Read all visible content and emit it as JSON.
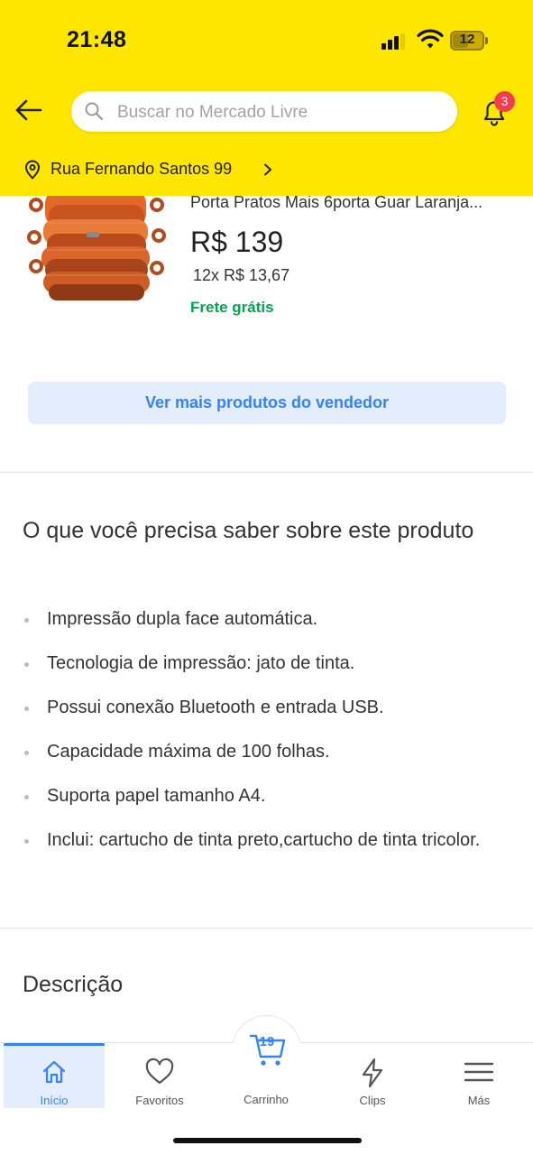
{
  "status_bar": {
    "time": "21:48",
    "battery": "12"
  },
  "header": {
    "search_placeholder": "Buscar no Mercado Livre",
    "notifications_count": "3",
    "location": "Rua Fernando Santos 99",
    "brand_color": "#FFE600"
  },
  "product": {
    "title": "Porta Pratos Mais 6porta Guar Laranja...",
    "price": "R$ 139",
    "installments": "12x R$ 13,67",
    "shipping": "Frete grátis"
  },
  "more_products_button": "Ver mais produtos do vendedor",
  "features": {
    "title": "O que você precisa saber sobre este produto",
    "items": [
      "Impressão dupla face automática.",
      "Tecnologia de impressão: jato de tinta.",
      "Possui conexão Bluetooth e entrada USB.",
      "Capacidade máxima de 100 folhas.",
      "Suporta papel tamanho A4.",
      "Inclui: cartucho de tinta preto,cartucho de tinta tricolor."
    ]
  },
  "description_title": "Descrição",
  "bottom_nav": {
    "home": "Início",
    "favorites": "Favoritos",
    "cart": "Carrinho",
    "cart_count": "19",
    "clips": "Clips",
    "more": "Más"
  },
  "colors": {
    "accent": "#3483FA",
    "accent_light": "#E3EDFB",
    "success": "#00A650",
    "badge": "#F23D4F"
  },
  "icons": [
    "back-arrow-icon",
    "search-icon",
    "bell-icon",
    "location-pin-icon",
    "chevron-right-icon",
    "home-icon",
    "heart-icon",
    "cart-icon",
    "bolt-icon",
    "menu-icon"
  ]
}
